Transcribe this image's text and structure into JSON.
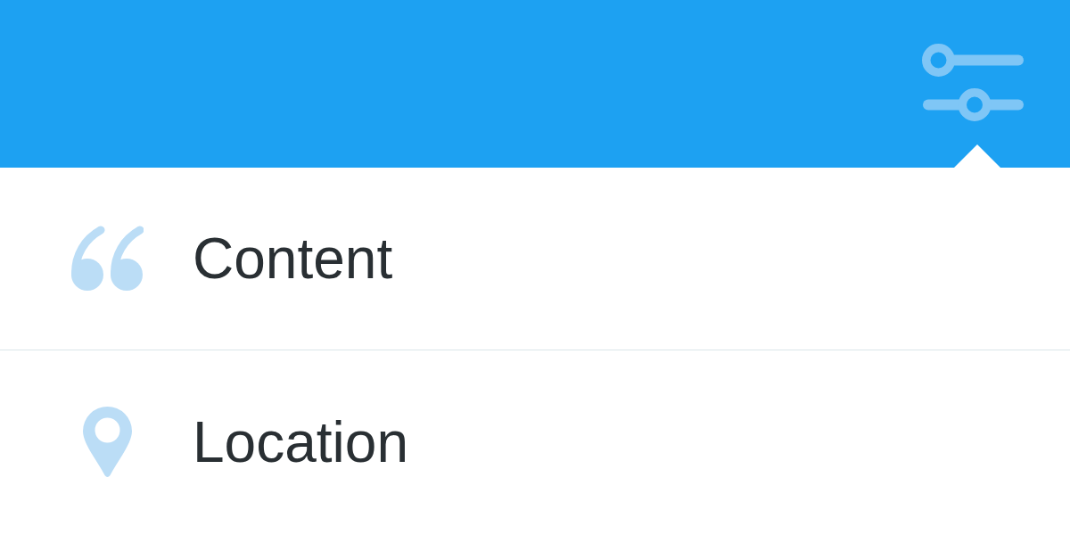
{
  "header": {
    "filter_button": {
      "expanded": true
    }
  },
  "menu": {
    "items": [
      {
        "label": "Content"
      },
      {
        "label": "Location"
      }
    ]
  }
}
